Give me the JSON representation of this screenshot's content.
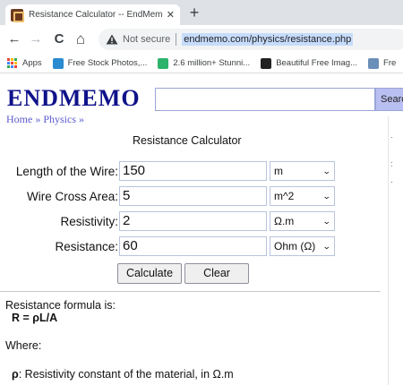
{
  "browser": {
    "tab_title": "Resistance Calculator -- EndMemo",
    "tab_close": "✕",
    "new_tab": "+",
    "not_secure": "Not secure",
    "url": "endmemo.com/physics/resistance.php",
    "nav": {
      "back": "←",
      "forward": "→",
      "reload": "C",
      "home": "⌂"
    }
  },
  "bookmarks": [
    {
      "label": "Apps",
      "icon_color": ""
    },
    {
      "label": "Free Stock Photos,...",
      "icon_color": "#2a8bd0"
    },
    {
      "label": "2.6 million+ Stunni...",
      "icon_color": "#2db36b"
    },
    {
      "label": "Beautiful Free Imag...",
      "icon_color": "#222222"
    },
    {
      "label": "Fre",
      "icon_color": "#6a8fb8"
    }
  ],
  "site": {
    "logo": "ENDMEMO",
    "search_button": "Search",
    "breadcrumb": {
      "home": "Home",
      "sep1": " » ",
      "physics": "Physics",
      "sep2": " »"
    }
  },
  "calculator": {
    "title": "Resistance Calculator",
    "rows": [
      {
        "label": "Length of the Wire:",
        "value": "150",
        "unit": "m"
      },
      {
        "label": "Wire Cross Area:",
        "value": "5",
        "unit": "m^2"
      },
      {
        "label": "Resistivity:",
        "value": "2",
        "unit": "Ω.m"
      },
      {
        "label": "Resistance:",
        "value": "60",
        "unit": "Ohm (Ω)"
      }
    ],
    "calculate": "Calculate",
    "clear": "Clear"
  },
  "content": {
    "formula_intro": "Resistance formula is:",
    "formula": "R = ρL/A",
    "where": "Where:",
    "rho_symbol": "ρ",
    "rho_text": ": Resistivity constant of the material, in Ω.m"
  },
  "colors": {
    "logo": "#10128a",
    "link": "#5a5ad0",
    "search_button": "#b9bff0"
  }
}
